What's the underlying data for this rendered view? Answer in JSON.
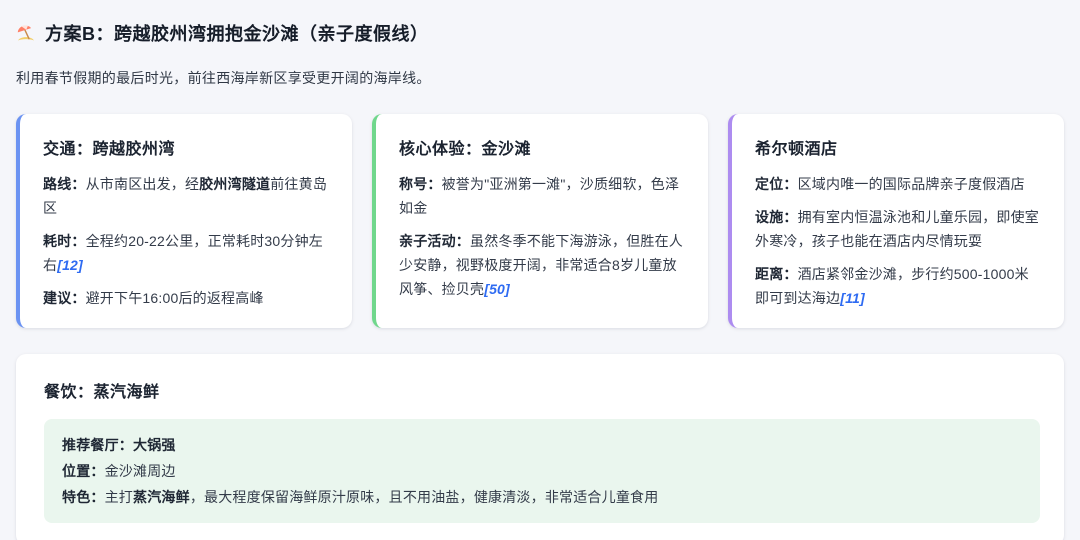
{
  "header": {
    "icon": "beach-umbrella",
    "title": "方案B：跨越胶州湾拥抱金沙滩（亲子度假线）",
    "subtitle": "利用春节假期的最后时光，前往西海岸新区享受更开阔的海岸线。"
  },
  "colors": {
    "page_bg": "#f5f6fa",
    "card_bg": "#ffffff",
    "accent_blue": "#6b93f2",
    "accent_green": "#70d78c",
    "accent_purple": "#ad8cf0",
    "link_blue": "#2e6bf2",
    "dining_box_bg": "#eaf6ee"
  },
  "cards": {
    "transport": {
      "title": "交通：跨越胶州湾",
      "route": {
        "label": "路线：",
        "pre": "从市南区出发，经",
        "bold": "胶州湾隧道",
        "post": "前往黄岛区"
      },
      "duration": {
        "label": "耗时：",
        "text": "全程约20-22公里，正常耗时30分钟左右",
        "citation": "[12]"
      },
      "advice": {
        "label": "建议：",
        "text": "避开下午16:00后的返程高峰"
      }
    },
    "experience": {
      "title": "核心体验：金沙滩",
      "reputation": {
        "label": "称号：",
        "text": "被誉为\"亚洲第一滩\"，沙质细软，色泽如金"
      },
      "family": {
        "label": "亲子活动：",
        "text": "虽然冬季不能下海游泳，但胜在人少安静，视野极度开阔，非常适合8岁儿童放风筝、捡贝壳",
        "citation": "[50]"
      }
    },
    "hotel": {
      "title": "希尔顿酒店",
      "positioning": {
        "label": "定位：",
        "text": "区域内唯一的国际品牌亲子度假酒店"
      },
      "facilities": {
        "label": "设施：",
        "text": "拥有室内恒温泳池和儿童乐园，即使室外寒冷，孩子也能在酒店内尽情玩耍"
      },
      "distance": {
        "label": "距离：",
        "text": "酒店紧邻金沙滩，步行约500-1000米即可到达海边",
        "citation": "[11]"
      }
    }
  },
  "dining": {
    "title": "餐饮：蒸汽海鲜",
    "restaurant": {
      "label": "推荐餐厅：",
      "value": "大锅强"
    },
    "location": {
      "label": "位置：",
      "value": "金沙滩周边"
    },
    "feature": {
      "label": "特色：",
      "pre": "主打",
      "bold": "蒸汽海鲜",
      "post": "，最大程度保留海鲜原汁原味，且不用油盐，健康清淡，非常适合儿童食用"
    }
  }
}
